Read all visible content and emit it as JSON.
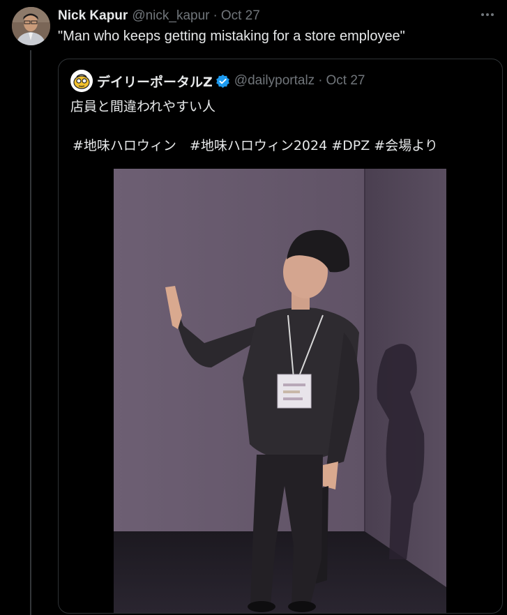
{
  "tweet": {
    "author_name": "Nick Kapur",
    "handle": "@nick_kapur",
    "separator": "·",
    "date": "Oct 27",
    "text": "\"Man who keeps getting mistaking for a store employee\""
  },
  "quote": {
    "author_name": "デイリーポータルZ",
    "handle": "@dailyportalz",
    "separator": "·",
    "date": "Oct 27",
    "text": "店員と間違われやすい人",
    "hashtags": "#地味ハロウィン　#地味ハロウィン2024 #DPZ #会場より"
  },
  "icons": {
    "more": "more-horizontal-icon",
    "verified": "verified-badge-icon"
  },
  "colors": {
    "background": "#000000",
    "primary_text": "#e7e9ea",
    "secondary_text": "#71767b",
    "border": "#2f3336",
    "verified_blue": "#1d9bf0"
  }
}
